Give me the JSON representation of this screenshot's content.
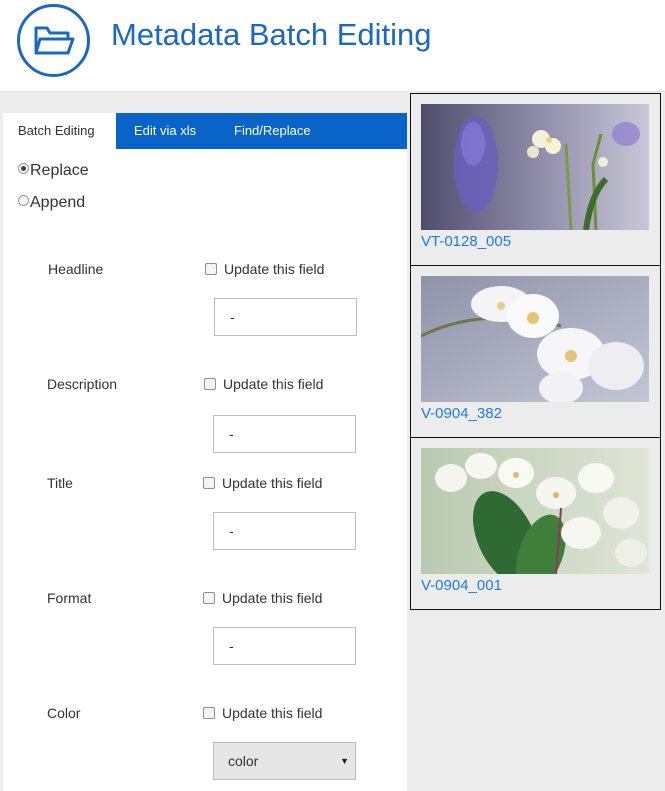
{
  "header": {
    "title": "Metadata Batch Editing",
    "logo_icon": "folder-open-icon",
    "brand_color": "#1a67c6"
  },
  "tabs": [
    {
      "label": "Batch Editing",
      "active": true
    },
    {
      "label": "Edit via xls",
      "active": false
    },
    {
      "label": "Find/Replace",
      "active": false
    }
  ],
  "mode": {
    "options": [
      {
        "label": "Replace",
        "checked": true
      },
      {
        "label": "Append",
        "checked": false
      }
    ]
  },
  "fields": [
    {
      "label": "Headline",
      "checkbox_label": "Update this field",
      "value": "-"
    },
    {
      "label": "Description",
      "checkbox_label": "Update this field",
      "value": "-"
    },
    {
      "label": "Title",
      "checkbox_label": "Update this field",
      "value": "-"
    },
    {
      "label": "Format",
      "checkbox_label": "Update this field",
      "value": "-"
    },
    {
      "label": "Color",
      "checkbox_label": "Update this field",
      "selected": "color"
    }
  ],
  "thumbnails": [
    {
      "name": "VT-0128_005"
    },
    {
      "name": "V-0904_382"
    },
    {
      "name": "V-0904_001"
    }
  ]
}
